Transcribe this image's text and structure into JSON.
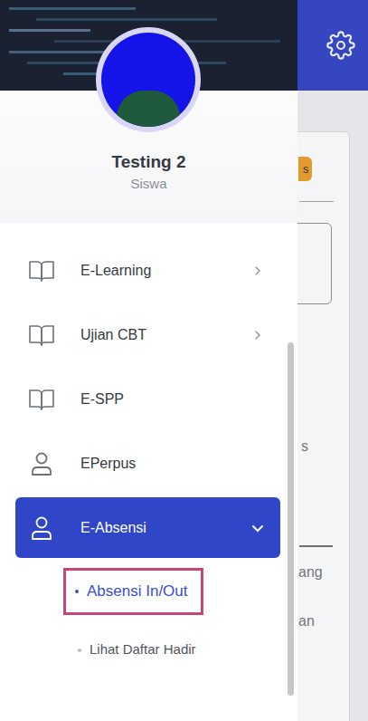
{
  "profile": {
    "name": "Testing 2",
    "role": "Siswa"
  },
  "sidebar": {
    "items": [
      {
        "label": "E-Learning",
        "kind": "book",
        "expandable": true,
        "expanded": false,
        "selected": false,
        "children": []
      },
      {
        "label": "Ujian CBT",
        "kind": "book",
        "expandable": true,
        "expanded": false,
        "selected": false,
        "children": []
      },
      {
        "label": "E-SPP",
        "kind": "book",
        "expandable": false,
        "expanded": false,
        "selected": false,
        "children": []
      },
      {
        "label": "EPerpus",
        "kind": "user",
        "expandable": false,
        "expanded": false,
        "selected": false,
        "children": []
      },
      {
        "label": "E-Absensi",
        "kind": "user",
        "expandable": true,
        "expanded": true,
        "selected": true,
        "children": [
          {
            "label": "Absensi In/Out",
            "selected": true,
            "highlighted": true
          },
          {
            "label": "Lihat Daftar Hadir",
            "selected": false,
            "highlighted": false
          }
        ]
      }
    ]
  },
  "background": {
    "badge": "s",
    "texts": [
      "s",
      "ang",
      "an"
    ]
  }
}
